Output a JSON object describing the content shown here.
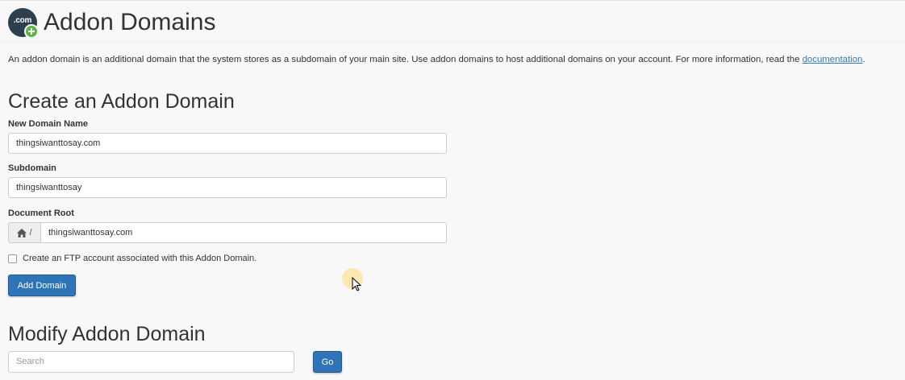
{
  "header": {
    "logo_text": ".com",
    "title": "Addon Domains"
  },
  "description": {
    "text": "An addon domain is an additional domain that the system stores as a subdomain of your main site. Use addon domains to host additional domains on your account. For more information, read the ",
    "link_text": "documentation",
    "suffix": "."
  },
  "create": {
    "title": "Create an Addon Domain",
    "new_domain_label": "New Domain Name",
    "new_domain_value": "thingsiwanttosay.com",
    "subdomain_label": "Subdomain",
    "subdomain_value": "thingsiwanttosay",
    "docroot_label": "Document Root",
    "docroot_prefix": "/",
    "docroot_value": "thingsiwanttosay.com",
    "ftp_label": "Create an FTP account associated with this Addon Domain.",
    "ftp_checked": false,
    "submit_label": "Add Domain"
  },
  "modify": {
    "title": "Modify Addon Domain",
    "search_placeholder": "Search",
    "go_label": "Go"
  },
  "icons": {
    "logo": "addon-domain-logo-icon",
    "home": "home-icon",
    "cursor": "mouse-pointer-icon"
  },
  "colors": {
    "primary_button": "#2f74b6",
    "link": "#337ab7",
    "logo_dark": "#2d3e4e",
    "logo_plus": "#5ab548"
  }
}
